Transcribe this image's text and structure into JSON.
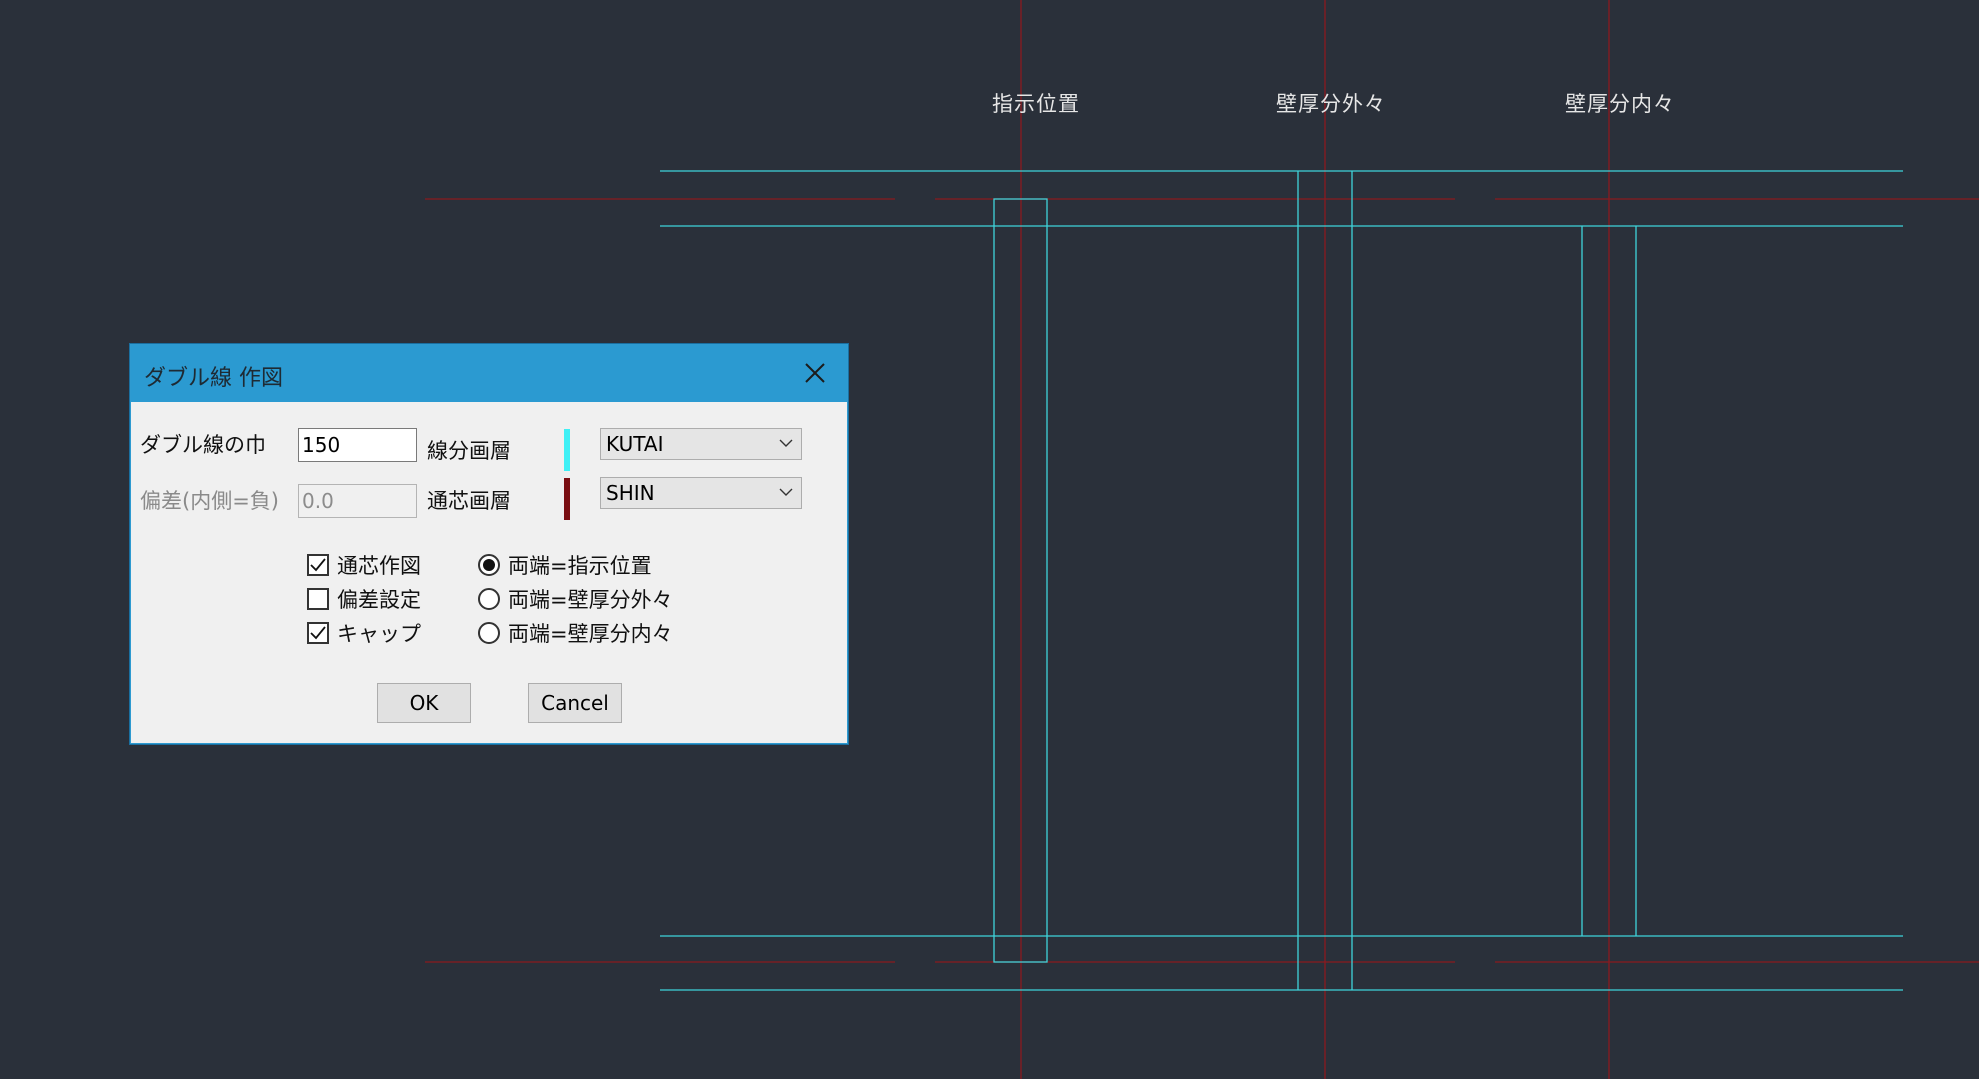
{
  "cad": {
    "labels": {
      "instruct": "指示位置",
      "outer": "壁厚分外々",
      "inner": "壁厚分内々"
    },
    "colors": {
      "background": "#2a303a",
      "cyan_line": "#3fd3db",
      "red_line": "#8b1a1f"
    }
  },
  "dialog": {
    "title": "ダブル線 作図",
    "width_label": "ダブル線の巾",
    "width_value": "150",
    "offset_label": "偏差(内側=負)",
    "offset_value": "0.0",
    "line_layer_label": "線分画層",
    "line_layer_value": "KUTAI",
    "line_layer_color": "#3ff0f5",
    "center_layer_label": "通芯画層",
    "center_layer_value": "SHIN",
    "center_layer_color": "#7a0e12",
    "checkboxes": [
      {
        "label": "通芯作図",
        "checked": true
      },
      {
        "label": "偏差設定",
        "checked": false
      },
      {
        "label": "キャップ",
        "checked": true
      }
    ],
    "radios": [
      {
        "label": "両端=指示位置",
        "selected": true
      },
      {
        "label": "両端=壁厚分外々",
        "selected": false
      },
      {
        "label": "両端=壁厚分内々",
        "selected": false
      }
    ],
    "ok_label": "OK",
    "cancel_label": "Cancel",
    "accent_color": "#2b9ad1"
  }
}
